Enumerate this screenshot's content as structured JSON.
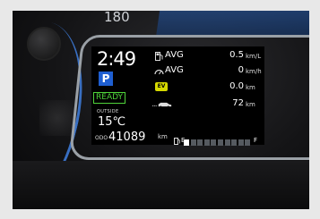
{
  "speedometer": {
    "top_mark": "180"
  },
  "display": {
    "clock": "2:49",
    "gear": "P",
    "status": "READY",
    "outside_label": "OUTSIDE",
    "temperature": "15℃",
    "odo_label": "ODO",
    "odometer": "41089",
    "odo_unit": "km",
    "rows": [
      {
        "label": "AVG",
        "value": "0.5",
        "unit": "km/L",
        "icon": "fuel-pump-icon"
      },
      {
        "label": "AVG",
        "value": "0",
        "unit": "km/h",
        "icon": "speedometer-icon"
      },
      {
        "label": "",
        "value": "0.0",
        "unit": "km",
        "icon": "ev-icon"
      },
      {
        "label": "",
        "value": "72",
        "unit": "km",
        "icon": "car-range-icon"
      }
    ],
    "ev_badge": "EV",
    "fuel": {
      "empty_label": "E",
      "full_label": "F",
      "level": 0.1,
      "segments": 10
    }
  },
  "colors": {
    "ready_green": "#4fd33a",
    "gear_blue": "#1f5fd1",
    "ev_yellow": "#d6d900"
  }
}
